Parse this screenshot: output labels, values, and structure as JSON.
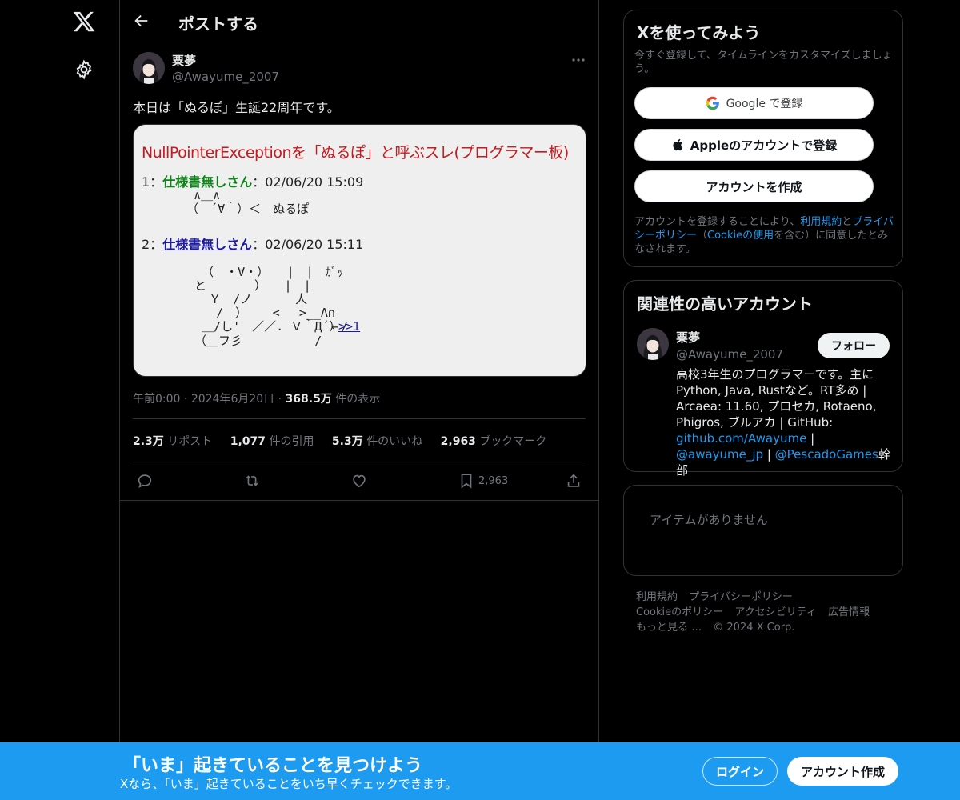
{
  "nav": {
    "logo_icon": "x-logo-icon",
    "settings_icon": "gear-icon"
  },
  "header": {
    "title": "ポストする",
    "back_icon": "arrow-left-icon"
  },
  "post": {
    "author_name": "粟夢",
    "author_handle": "@Awayume_2007",
    "text": "本日は「ぬるぽ」生誕22周年です。",
    "image": {
      "title": "NullPointerExceptionを「ぬるぽ」と呼ぶスレ(プログラマー板)",
      "post1_num": "1：",
      "post1_name": "仕様書無しさん",
      "post1_date": "：02/06/20 15:09",
      "post1_aa": "   ∧＿∧\n  （　´∀｀）＜　ぬるぽ",
      "post2_num": "2：",
      "post2_name": "仕様書無しさん",
      "post2_date": "：02/06/20 15:11",
      "post2_aa": "   （　・∀・）　　|　|　ｶﾞｯ\n  と　　　　）　　|　|\n    Ｙ　/ノ　　　 人\n     /　）　　 <　 >__Λ∩\n   ＿/し'　／／. Ｖ｀Д´）/",
      "post2_anchor": "←",
      "post2_link": ">>1",
      "post2_aa_tail": "  （＿フ彡　　　　　　/"
    },
    "time": "午前0:00",
    "date": "2024年6月20日",
    "views_count": "368.5万",
    "views_label": "件の表示",
    "reposts_count": "2.3万",
    "reposts_label": "リポスト",
    "quotes_count": "1,077",
    "quotes_label": "件の引用",
    "likes_count": "5.3万",
    "likes_label": "件のいいね",
    "bookmarks_count": "2,963",
    "bookmarks_label": "ブックマーク",
    "actions": {
      "reply_icon": "reply-icon",
      "repost_icon": "repost-icon",
      "like_icon": "heart-icon",
      "bookmark_icon": "bookmark-icon",
      "bookmark_count": "2,963",
      "share_icon": "share-icon"
    }
  },
  "signup_card": {
    "title": "Xを使ってみよう",
    "subtitle": "今すぐ登録して、タイムラインをカスタマイズしましょう。",
    "google_label": "Google で登録",
    "apple_label": "Appleのアカウントで登録",
    "create_label": "アカウントを作成",
    "legal_prefix": "アカウントを登録することにより、",
    "legal_terms": "利用規約",
    "legal_and": "と",
    "legal_privacy": "プライバシーポリシー",
    "legal_cookie_open": "（",
    "legal_cookie": "Cookieの使用",
    "legal_suffix": "を含む）に同意したとみなされます。"
  },
  "relevant_card": {
    "title": "関連性の高いアカウント",
    "name": "粟夢",
    "handle": "@Awayume_2007",
    "follow_label": "フォロー",
    "bio_text1": "高校3年生のプログラマーです。主にPython, Java, Rustなど。RT多め | Arcaea: 11.60, プロセカ, Rotaeno, Phigros, ブルアカ | GitHub: ",
    "bio_link1": "github.com/Awayume",
    "bio_sep1": " | ",
    "bio_link2": "@awayume_jp",
    "bio_sep2": " | ",
    "bio_link3": "@PescadoGames",
    "bio_tail": "幹部"
  },
  "trends_card": {
    "empty_text": "アイテムがありません"
  },
  "footer": {
    "terms": "利用規約",
    "privacy": "プライバシーポリシー",
    "cookie": "Cookieのポリシー",
    "accessibility": "アクセシビリティ",
    "ads": "広告情報",
    "more": "もっと見る …",
    "copyright": "© 2024 X Corp."
  },
  "banner": {
    "title": "「いま」起きていることを見つけよう",
    "subtitle": "Xなら、「いま」起きていることをいち早くチェックできます。",
    "login_label": "ログイン",
    "signup_label": "アカウント作成"
  },
  "colors": {
    "accent": "#1d9bf0",
    "background": "#000000",
    "border": "#2f3336",
    "muted": "#71767b"
  }
}
